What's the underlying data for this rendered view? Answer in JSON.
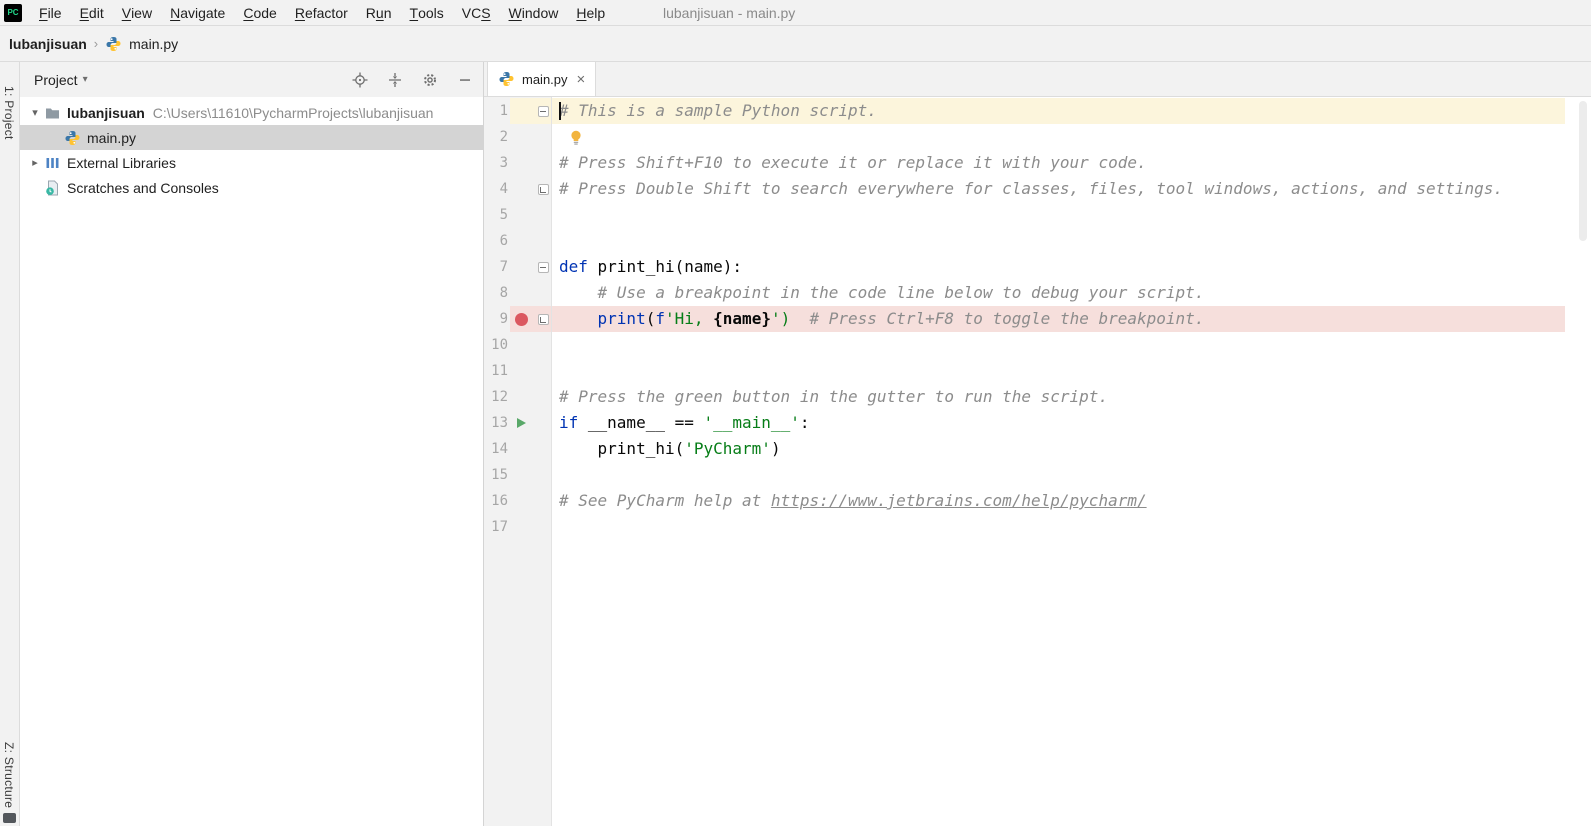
{
  "window": {
    "logo_text": "PC",
    "title": "lubanjisuan - main.py"
  },
  "menu": {
    "items": [
      {
        "label": "File",
        "mnemonic": "F"
      },
      {
        "label": "Edit",
        "mnemonic": "E"
      },
      {
        "label": "View",
        "mnemonic": "V"
      },
      {
        "label": "Navigate",
        "mnemonic": "N"
      },
      {
        "label": "Code",
        "mnemonic": "C"
      },
      {
        "label": "Refactor",
        "mnemonic": "R"
      },
      {
        "label": "Run",
        "mnemonic": "u"
      },
      {
        "label": "Tools",
        "mnemonic": "T"
      },
      {
        "label": "VCS",
        "mnemonic": "S"
      },
      {
        "label": "Window",
        "mnemonic": "W"
      },
      {
        "label": "Help",
        "mnemonic": "H"
      }
    ]
  },
  "breadcrumb": {
    "project": "lubanjisuan",
    "separator": "›",
    "file": "main.py"
  },
  "stripes": {
    "left_top": "1: Project",
    "left_bottom": "Z: Structure"
  },
  "project": {
    "title": "Project",
    "toolbar_icons": [
      "locate",
      "collapse-all",
      "settings",
      "hide"
    ],
    "tree": [
      {
        "label": "lubanjisuan",
        "path": "C:\\Users\\11610\\PycharmProjects\\lubanjisuan",
        "icon": "folder",
        "chevron": "down",
        "bold": true,
        "indent": 0,
        "selected": false
      },
      {
        "label": "main.py",
        "icon": "python",
        "indent": 1,
        "selected": true
      },
      {
        "label": "External Libraries",
        "icon": "libraries",
        "chevron": "right",
        "indent": 0,
        "selected": false
      },
      {
        "label": "Scratches and Consoles",
        "icon": "scratches",
        "indent": 0,
        "selected": false
      }
    ]
  },
  "editor": {
    "tab": {
      "label": "main.py",
      "close_glyph": "×"
    },
    "lines": [
      {
        "n": 1,
        "caret": true,
        "fold": "start",
        "tokens": [
          {
            "t": "# This is a sample Python script.",
            "c": "comment"
          }
        ]
      },
      {
        "n": 2,
        "bulb": true,
        "tokens": []
      },
      {
        "n": 3,
        "tokens": [
          {
            "t": "# Press Shift+F10 to execute it or replace it with your code.",
            "c": "comment"
          }
        ]
      },
      {
        "n": 4,
        "fold": "end",
        "tokens": [
          {
            "t": "# Press Double Shift to search everywhere for classes, files, tool windows, actions, and settings.",
            "c": "comment"
          }
        ]
      },
      {
        "n": 5,
        "tokens": []
      },
      {
        "n": 6,
        "tokens": []
      },
      {
        "n": 7,
        "fold": "start",
        "tokens": [
          {
            "t": "def",
            "c": "kw"
          },
          {
            "t": " print_hi(name):",
            "c": "plain"
          }
        ]
      },
      {
        "n": 8,
        "tokens": [
          {
            "t": "    # Use a breakpoint in the code line below to debug your script.",
            "c": "comment"
          }
        ]
      },
      {
        "n": 9,
        "breakpoint": true,
        "fold": "end",
        "tokens": [
          {
            "t": "    ",
            "c": "plain"
          },
          {
            "t": "print",
            "c": "kw"
          },
          {
            "t": "(",
            "c": "plain"
          },
          {
            "t": "f",
            "c": "kw"
          },
          {
            "t": "'Hi, ",
            "c": "str"
          },
          {
            "t": "{name}",
            "c": "plainb"
          },
          {
            "t": "')",
            "c": "str"
          },
          {
            "t": "  # Press Ctrl+F8 to toggle the breakpoint.",
            "c": "comment"
          }
        ]
      },
      {
        "n": 10,
        "tokens": []
      },
      {
        "n": 11,
        "tokens": []
      },
      {
        "n": 12,
        "tokens": [
          {
            "t": "# Press the green button in the gutter to run the script.",
            "c": "comment"
          }
        ]
      },
      {
        "n": 13,
        "run": true,
        "tokens": [
          {
            "t": "if",
            "c": "kw"
          },
          {
            "t": " __name__ == ",
            "c": "plain"
          },
          {
            "t": "'__main__'",
            "c": "str"
          },
          {
            "t": ":",
            "c": "plain"
          }
        ]
      },
      {
        "n": 14,
        "tokens": [
          {
            "t": "    print_hi(",
            "c": "plain"
          },
          {
            "t": "'PyCharm'",
            "c": "str"
          },
          {
            "t": ")",
            "c": "plain"
          }
        ]
      },
      {
        "n": 15,
        "tokens": []
      },
      {
        "n": 16,
        "tokens": [
          {
            "t": "# See PyCharm help at ",
            "c": "comment"
          },
          {
            "t": "https://www.jetbrains.com/help/pycharm/",
            "c": "link"
          }
        ]
      },
      {
        "n": 17,
        "tokens": []
      }
    ]
  },
  "colors": {
    "keyword": "#0033b3",
    "string": "#067d17",
    "comment": "#8c8c8c",
    "plain": "#080808",
    "caret_line_bg": "#fcf5dc",
    "breakpoint_line_bg": "#f6dfdc",
    "breakpoint_red": "#db5860",
    "run_green": "#59a869",
    "selection_bg": "#d4d4d4"
  }
}
